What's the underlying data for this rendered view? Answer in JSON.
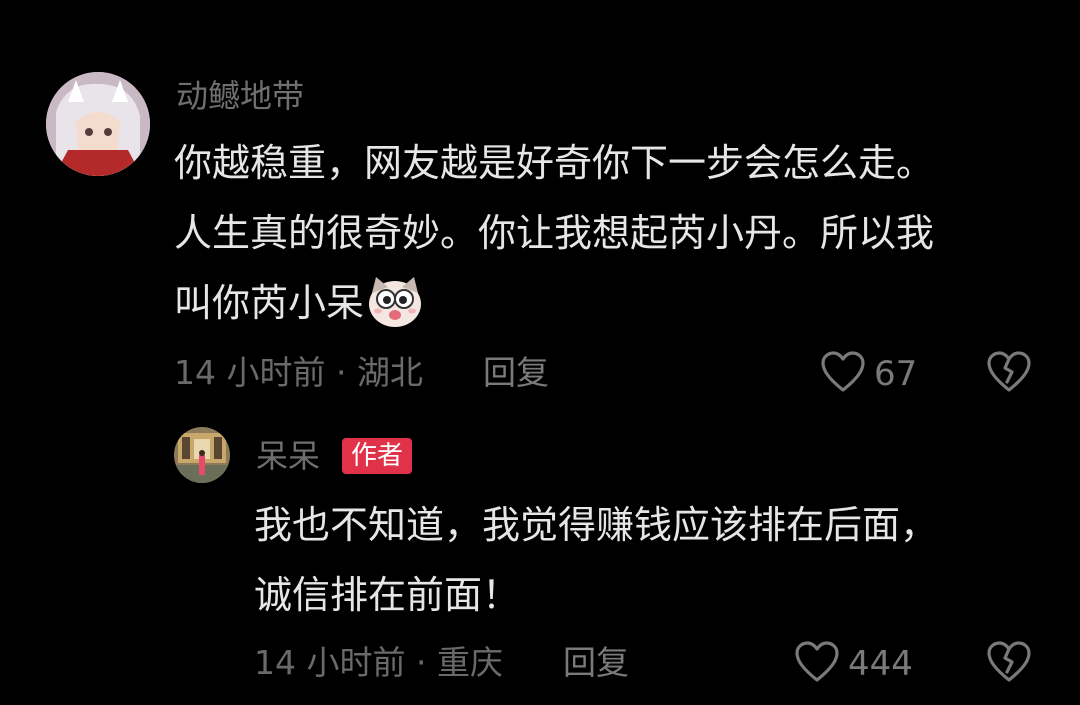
{
  "comments": [
    {
      "username": "动鳡地带",
      "lines": [
        "你越稳重，网友越是好奇你下一步会怎么走。",
        "人生真的很奇妙。你让我想起芮小丹。所以我",
        "叫你芮小呆"
      ],
      "emoji": "cat-face-emoji",
      "meta": "14 小时前 · 湖北",
      "reply_label": "回复",
      "likes": "67"
    },
    {
      "username": "呆呆",
      "badge": "作者",
      "lines": [
        "我也不知道，我觉得赚钱应该排在后面，",
        "诚信排在前面！"
      ],
      "meta": "14 小时前 · 重庆",
      "reply_label": "回复",
      "likes": "444"
    }
  ],
  "colors": {
    "background": "#000000",
    "badge": "#e0334a",
    "text": "#e6e6e6",
    "muted": "#6f6f6f"
  },
  "icons": [
    "heart-outline-icon",
    "broken-heart-icon"
  ]
}
